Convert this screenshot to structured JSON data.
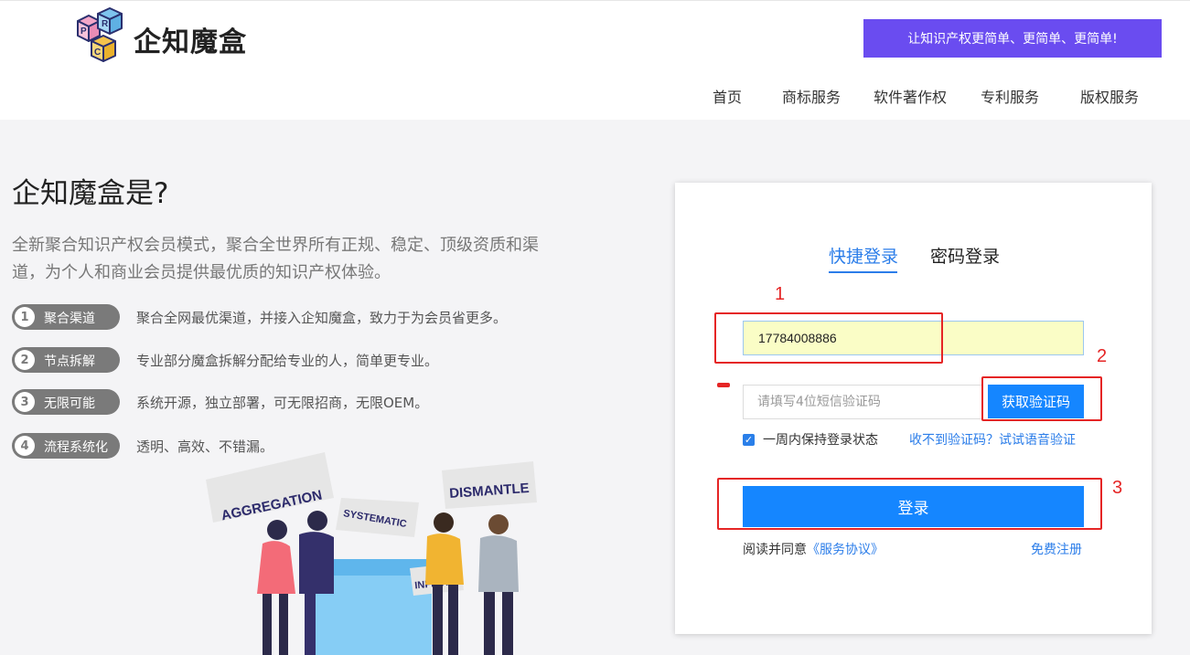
{
  "header": {
    "logo_text": "企知魔盒",
    "logo_letters": [
      "P",
      "R",
      "C"
    ],
    "slogan": "让知识产权更简单、更简单、更简单!",
    "nav": [
      "首页",
      "商标服务",
      "软件著作权",
      "专利服务",
      "版权服务"
    ]
  },
  "intro": {
    "title": "企知魔盒是?",
    "desc": "全新聚合知识产权会员模式，聚合全世界所有正规、稳定、顶级资质和渠道，为个人和商业会员提供最优质的知识产权体验。",
    "features": [
      {
        "num": "1",
        "label": "聚合渠道",
        "desc": "聚合全网最优渠道，并接入企知魔盒，致力于为会员省更多。"
      },
      {
        "num": "2",
        "label": "节点拆解",
        "desc": "专业部分魔盒拆解分配给专业的人，简单更专业。"
      },
      {
        "num": "3",
        "label": "无限可能",
        "desc": "系统开源，独立部署，可无限招商，无限OEM。"
      },
      {
        "num": "4",
        "label": "流程系统化",
        "desc": "透明、高效、不错漏。"
      }
    ],
    "illustration_signs": [
      "AGGREGATION",
      "SYSTEMATIC",
      "DISMANTLE",
      "INFINITY"
    ]
  },
  "login": {
    "tab_quick": "快捷登录",
    "tab_password": "密码登录",
    "phone_value": "17784008886",
    "code_placeholder": "请填写4位短信验证码",
    "get_code": "获取验证码",
    "keep_login": "一周内保持登录状态",
    "voice_verify": "收不到验证码？试试语音验证",
    "login_button": "登录",
    "agree_prefix": "阅读并同意",
    "agree_link": "《服务协议》",
    "register": "免费注册"
  },
  "annotations": [
    "1",
    "2",
    "3"
  ],
  "colors": {
    "accent": "#1586ff",
    "slogan_bg": "#6a4cf0",
    "annotation_red": "#e52525",
    "phone_bg": "#fafdc6"
  }
}
